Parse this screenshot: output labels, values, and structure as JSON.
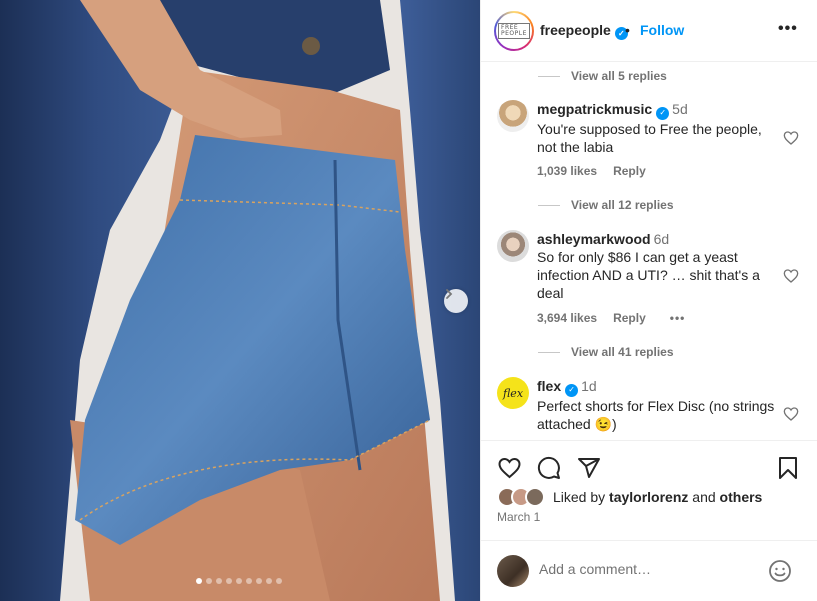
{
  "post": {
    "username": "freepeople",
    "avatar_text": "FREE PEOPLE",
    "follow_label": "Follow",
    "separator": "•",
    "more_label": "•••",
    "carousel": {
      "total": 9,
      "current": 1
    }
  },
  "comments": [
    {
      "type": "view_replies",
      "label": "View all 5 replies"
    },
    {
      "type": "comment",
      "user": "megpatrickmusic",
      "verified": true,
      "time": "5d",
      "text": "You're supposed to Free the people, not the labia",
      "likes": "1,039 likes",
      "reply_label": "Reply"
    },
    {
      "type": "view_replies",
      "label": "View all 12 replies"
    },
    {
      "type": "comment",
      "user": "ashleymarkwood",
      "verified": false,
      "time": "6d",
      "text": "So for only $86 I can get a yeast infection AND a UTI? … shit that's a deal",
      "likes": "3,694 likes",
      "reply_label": "Reply",
      "more_label": "•••"
    },
    {
      "type": "view_replies",
      "label": "View all 41 replies"
    },
    {
      "type": "comment",
      "user": "flex",
      "verified": true,
      "time": "1d",
      "text": "Perfect shorts for Flex Disc (no strings attached 😉)",
      "avatar_text": "flex"
    }
  ],
  "actions": {
    "icons": [
      "heart-icon",
      "comment-icon",
      "share-icon",
      "bookmark-icon"
    ],
    "liked_prefix": "Liked by",
    "liked_user": "taylorlorenz",
    "liked_join": "and",
    "liked_suffix": "others",
    "date": "March 1"
  },
  "add_comment": {
    "placeholder": "Add a comment…"
  },
  "colors": {
    "accent": "#0095f6",
    "text": "#262626",
    "secondary": "#737373",
    "flex_yellow": "#f5e31a"
  }
}
